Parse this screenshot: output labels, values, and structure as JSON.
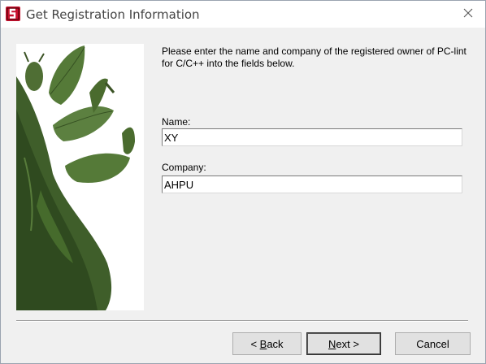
{
  "window": {
    "title": "Get Registration Information",
    "app_icon": "pc-lint-red-logo-icon",
    "close_icon": "close-x-icon"
  },
  "image_panel": {
    "depicts": "leaf-insect-illustration"
  },
  "instructions": {
    "text": "Please enter the name and company of the registered owner of PC-lint for C/C++ into the fields below."
  },
  "form": {
    "name_label": "Name:",
    "name_value": "XY",
    "company_label": "Company:",
    "company_value": "AHPU"
  },
  "buttons": {
    "back_mnemonic": "B",
    "back_rest": "ack",
    "back_prefix": "<",
    "next_mnemonic": "N",
    "next_rest": "ext",
    "next_suffix": ">",
    "cancel_label": "Cancel"
  },
  "colors": {
    "title_bg": "#ffffff",
    "dialog_bg": "#f0f0f0",
    "icon_red": "#c8102e",
    "leaf_green": "#4a6b2e"
  }
}
